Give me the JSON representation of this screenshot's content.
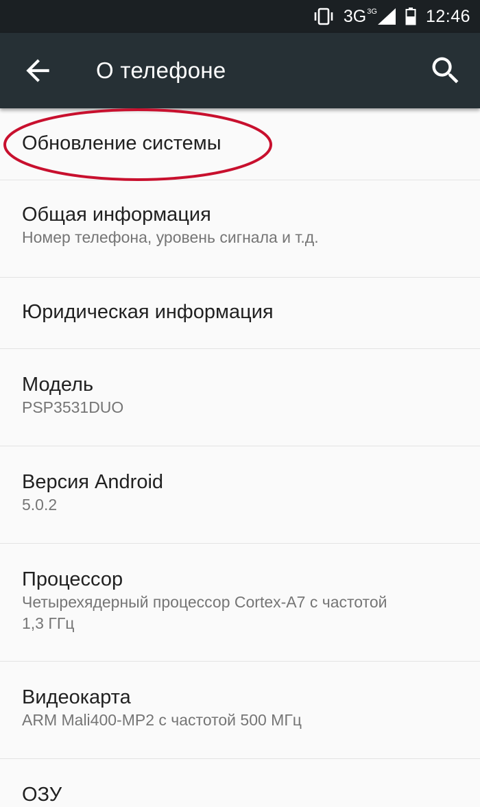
{
  "status_bar": {
    "network": "3G",
    "network_sup": "3G",
    "time": "12:46",
    "icons": [
      "vibrate-icon",
      "signal-icon",
      "battery-icon"
    ]
  },
  "app_bar": {
    "title": "О телефоне",
    "back_icon": "arrow-back-icon",
    "search_icon": "search-icon"
  },
  "items": [
    {
      "title": "Обновление системы",
      "summary": ""
    },
    {
      "title": "Общая информация",
      "summary": "Номер телефона, уровень сигнала и т.д."
    },
    {
      "title": "Юридическая информация",
      "summary": ""
    },
    {
      "title": "Модель",
      "summary": "PSP3531DUO"
    },
    {
      "title": "Версия Android",
      "summary": "5.0.2"
    },
    {
      "title": "Процессор",
      "summary": "Четырехядерный процессор Cortex-A7 с частотой 1,3 ГГц"
    },
    {
      "title": "Видеокарта",
      "summary": "ARM Mali400-MP2 с частотой 500 МГц"
    },
    {
      "title": "ОЗУ",
      "summary": ""
    }
  ],
  "colors": {
    "status_bar": "#1b2023",
    "app_bar": "#263035",
    "background": "#fafafa",
    "highlight": "#c8102e"
  }
}
